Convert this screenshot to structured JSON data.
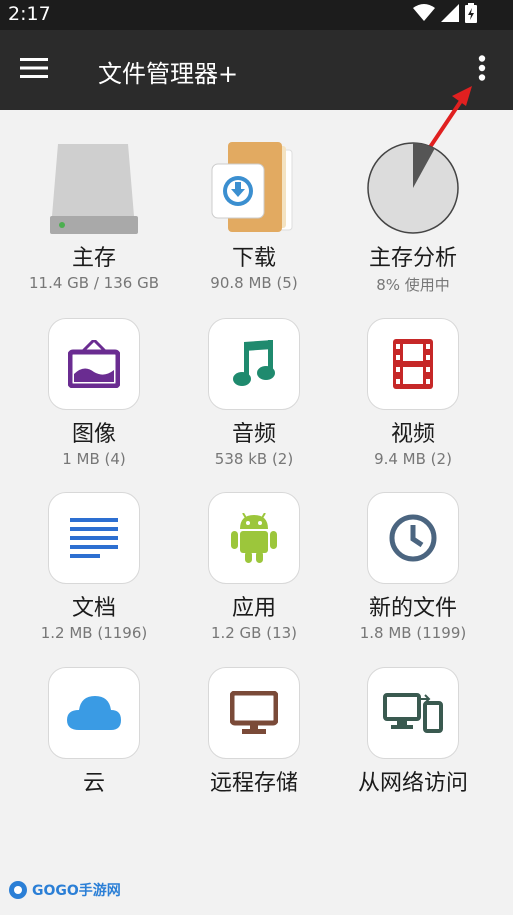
{
  "status": {
    "time": "2:17"
  },
  "app": {
    "title": "文件管理器+"
  },
  "icons": {
    "menu": "hamburger-menu-icon",
    "overflow": "more-vert-icon",
    "wifi": "wifi-icon",
    "signal": "signal-icon",
    "battery": "battery-charging-icon"
  },
  "colors": {
    "app_bar": "#2b2b2b",
    "status_bar": "#1c1c1c",
    "background": "#f2f2f2",
    "arrow": "#e02020",
    "image_icon": "#6a2c91",
    "music_icon": "#1f8a6e",
    "video_icon": "#c62828",
    "docs_icon": "#2d6fd1",
    "android_icon": "#9cc63b",
    "clock_icon": "#4b6580",
    "cloud_icon": "#3a9be4",
    "remote_icon": "#7a4a38",
    "network_icon": "#3a5a50"
  },
  "tiles": [
    {
      "name": "主存",
      "sub": "11.4 GB / 136 GB",
      "icon": "hard-drive-icon"
    },
    {
      "name": "下载",
      "sub": "90.8 MB (5)",
      "icon": "download-folder-icon"
    },
    {
      "name": "主存分析",
      "sub": "8% 使用中",
      "icon": "storage-pie-icon",
      "usage_fraction": 0.08
    },
    {
      "name": "图像",
      "sub": "1 MB (4)",
      "icon": "image-icon"
    },
    {
      "name": "音频",
      "sub": "538 kB (2)",
      "icon": "music-note-icon"
    },
    {
      "name": "视频",
      "sub": "9.4 MB (2)",
      "icon": "film-icon"
    },
    {
      "name": "文档",
      "sub": "1.2 MB (1196)",
      "icon": "document-icon"
    },
    {
      "name": "应用",
      "sub": "1.2 GB (13)",
      "icon": "android-icon"
    },
    {
      "name": "新的文件",
      "sub": "1.8 MB (1199)",
      "icon": "clock-icon"
    },
    {
      "name": "云",
      "sub": "",
      "icon": "cloud-icon"
    },
    {
      "name": "远程存储",
      "sub": "",
      "icon": "monitor-icon"
    },
    {
      "name": "从网络访问",
      "sub": "",
      "icon": "network-devices-icon"
    }
  ],
  "watermark": {
    "text": "GOGO手游网"
  }
}
